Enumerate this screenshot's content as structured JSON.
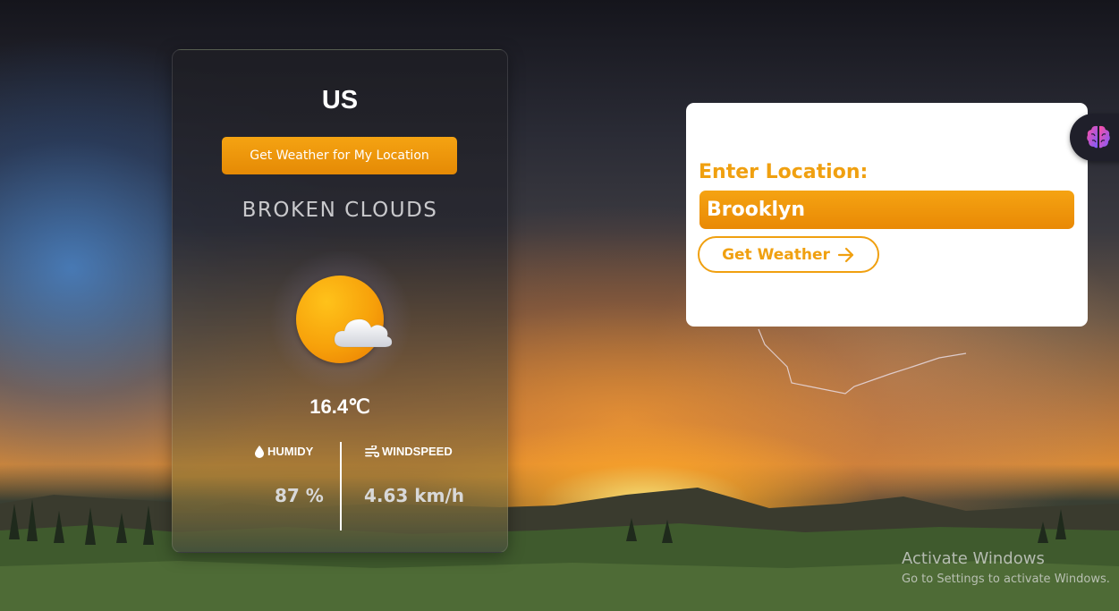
{
  "weather_card": {
    "location": "US",
    "my_location_button": "Get Weather for My Location",
    "condition": "BROKEN CLOUDS",
    "icon": "sun-behind-cloud-icon",
    "temperature": "16.4℃",
    "humidity": {
      "label": "HUMIDY",
      "value": "87 %",
      "icon": "water-drop-icon"
    },
    "windspeed": {
      "label": "WINDSPEED",
      "value": "4.63 km/h",
      "icon": "wind-icon"
    }
  },
  "search_panel": {
    "label": "Enter Location:",
    "input_value": "Brooklyn",
    "button_label": "Get Weather",
    "button_icon": "arrow-right-icon"
  },
  "extension_tab": {
    "icon": "brain-icon"
  },
  "watermark": {
    "title": "Activate Windows",
    "subtitle": "Go to Settings to activate Windows."
  },
  "colors": {
    "accent": "#f0a010",
    "button_gradient_top": "#f5a312",
    "button_gradient_bottom": "#e58a05",
    "panel_bg": "#ffffff"
  }
}
